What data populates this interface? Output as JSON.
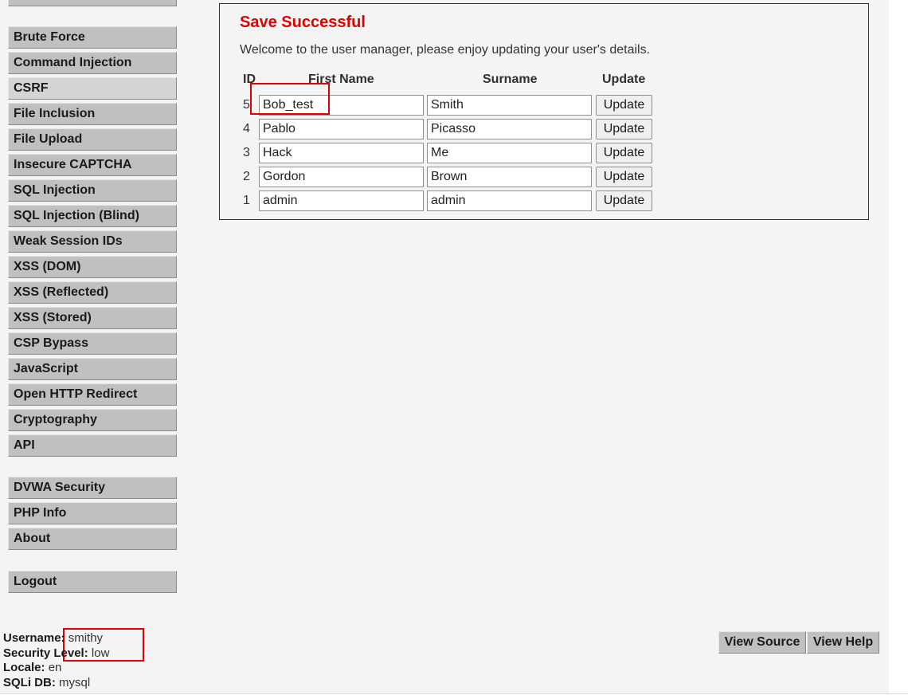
{
  "sidebar": {
    "group1": [
      {
        "label": "Brute Force"
      },
      {
        "label": "Command Injection"
      },
      {
        "label": "CSRF"
      },
      {
        "label": "File Inclusion"
      },
      {
        "label": "File Upload"
      },
      {
        "label": "Insecure CAPTCHA"
      },
      {
        "label": "SQL Injection"
      },
      {
        "label": "SQL Injection (Blind)"
      },
      {
        "label": "Weak Session IDs"
      },
      {
        "label": "XSS (DOM)"
      },
      {
        "label": "XSS (Reflected)"
      },
      {
        "label": "XSS (Stored)"
      },
      {
        "label": "CSP Bypass"
      },
      {
        "label": "JavaScript"
      },
      {
        "label": "Open HTTP Redirect"
      },
      {
        "label": "Cryptography"
      },
      {
        "label": "API"
      }
    ],
    "group2": [
      {
        "label": "DVWA Security"
      },
      {
        "label": "PHP Info"
      },
      {
        "label": "About"
      }
    ],
    "group3": [
      {
        "label": "Logout"
      }
    ]
  },
  "main": {
    "title": "Save Successful",
    "welcome": "Welcome to the user manager, please enjoy updating your user's details.",
    "columns": {
      "id": "ID",
      "first": "First Name",
      "surname": "Surname",
      "update": "Update"
    },
    "rows": [
      {
        "id": "5",
        "first": "Bob_test",
        "surname": "Smith",
        "button": "Update"
      },
      {
        "id": "4",
        "first": "Pablo",
        "surname": "Picasso",
        "button": "Update"
      },
      {
        "id": "3",
        "first": "Hack",
        "surname": "Me",
        "button": "Update"
      },
      {
        "id": "2",
        "first": "Gordon",
        "surname": "Brown",
        "button": "Update"
      },
      {
        "id": "1",
        "first": "admin",
        "surname": "admin",
        "button": "Update"
      }
    ]
  },
  "info": {
    "username_label": "Username:",
    "username": "smithy",
    "security_label": "Security Level:",
    "security": "low",
    "locale_label": "Locale:",
    "locale": "en",
    "sqli_label": "SQLi DB:",
    "sqli": "mysql"
  },
  "buttons": {
    "view_source": "View Source",
    "view_help": "View Help"
  },
  "colors": {
    "title": "#e00000",
    "highlight": "#e00000",
    "menu_bg": "#c0c0c0"
  }
}
